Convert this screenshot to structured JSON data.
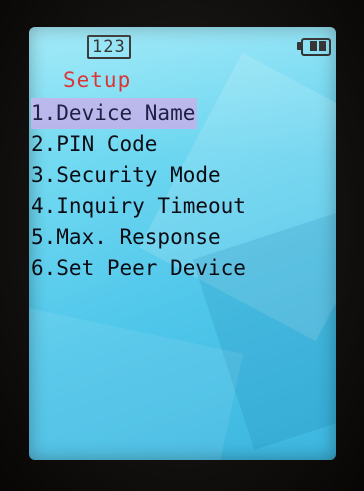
{
  "status_bar": {
    "input_mode": "123",
    "battery_icon": "battery-icon",
    "battery_level": "2 of 2 bars"
  },
  "screen": {
    "title": "Setup"
  },
  "menu": {
    "selected_index": 0,
    "items": [
      {
        "label": "1.Device Name"
      },
      {
        "label": "2.PIN Code"
      },
      {
        "label": "3.Security Mode"
      },
      {
        "label": "4.Inquiry Timeout"
      },
      {
        "label": "5.Max. Response"
      },
      {
        "label": "6.Set Peer Device"
      }
    ]
  },
  "colors": {
    "title": "#d81d1d",
    "selection_highlight": "#b6b3ea",
    "background": "#6fd8f1"
  }
}
